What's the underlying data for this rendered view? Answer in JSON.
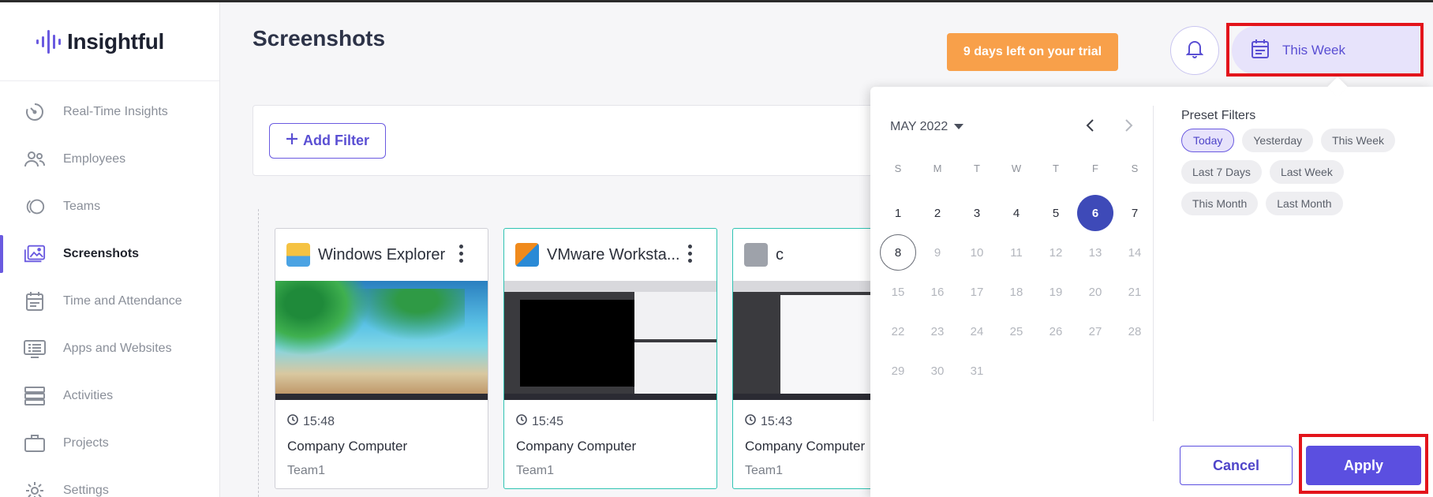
{
  "app": {
    "name": "Insightful"
  },
  "sidebar": {
    "items": [
      {
        "label": "Real-Time Insights",
        "icon": "gauge-icon"
      },
      {
        "label": "Employees",
        "icon": "people-icon"
      },
      {
        "label": "Teams",
        "icon": "teams-icon"
      },
      {
        "label": "Screenshots",
        "icon": "image-icon",
        "active": true
      },
      {
        "label": "Time and Attendance",
        "icon": "calendar-icon"
      },
      {
        "label": "Apps and Websites",
        "icon": "monitor-list-icon"
      },
      {
        "label": "Activities",
        "icon": "stack-icon"
      },
      {
        "label": "Projects",
        "icon": "briefcase-icon"
      },
      {
        "label": "Settings",
        "icon": "gear-icon"
      }
    ]
  },
  "header": {
    "title": "Screenshots",
    "trial_text": "9 days left on your trial",
    "date_range_label": "This Week"
  },
  "filters": {
    "add_filter_label": "Add Filter"
  },
  "cards": [
    {
      "app": "Windows Explorer",
      "time": "15:48",
      "computer": "Company Computer",
      "team": "Team1"
    },
    {
      "app": "VMware Worksta...",
      "time": "15:45",
      "computer": "Company Computer",
      "team": "Team1"
    },
    {
      "app": "c",
      "time": "15:43",
      "computer": "Company Computer",
      "team": "Team1"
    }
  ],
  "datepicker": {
    "month_label": "MAY 2022",
    "weekdays": [
      "S",
      "M",
      "T",
      "W",
      "T",
      "F",
      "S"
    ],
    "days": [
      "1",
      "2",
      "3",
      "4",
      "5",
      "6",
      "7",
      "8",
      "9",
      "10",
      "11",
      "12",
      "13",
      "14",
      "15",
      "16",
      "17",
      "18",
      "19",
      "20",
      "21",
      "22",
      "23",
      "24",
      "25",
      "26",
      "27",
      "28",
      "29",
      "30",
      "31"
    ],
    "selected_day": "6",
    "today_day": "8",
    "preset_title": "Preset Filters",
    "presets": [
      "Today",
      "Yesterday",
      "This Week",
      "Last 7 Days",
      "Last Week",
      "This Month",
      "Last Month"
    ],
    "active_preset": "Today",
    "cancel_label": "Cancel",
    "apply_label": "Apply"
  },
  "colors": {
    "accent": "#6a5ae0",
    "trial": "#f8a04a",
    "selected_day": "#3e4ab8",
    "highlight": "#e3141b"
  }
}
